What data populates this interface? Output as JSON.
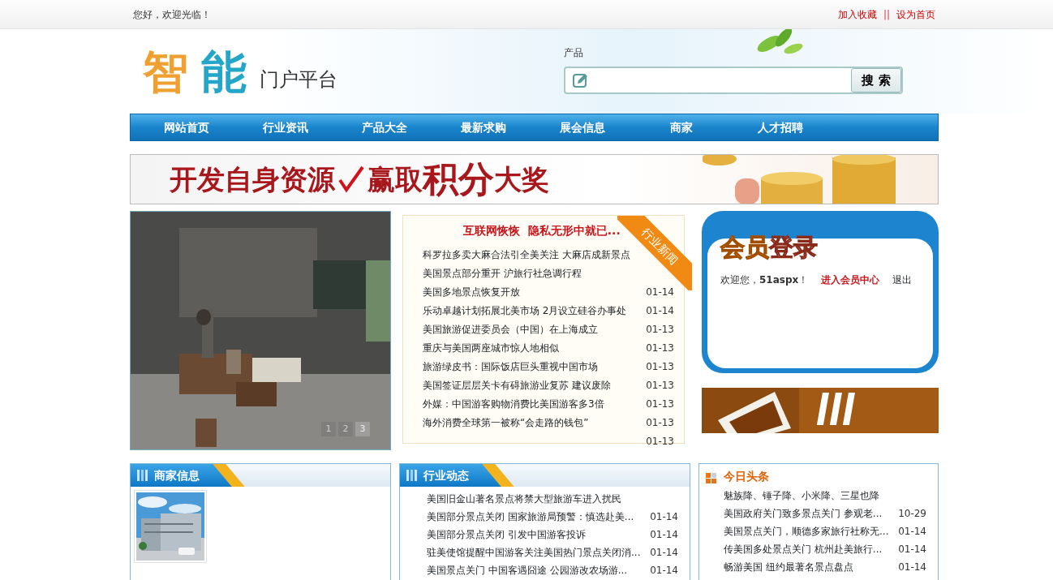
{
  "top_bar": {
    "greeting": "您好，欢迎光临！",
    "links": [
      "加入收藏",
      "设为首页"
    ],
    "separator": "||"
  },
  "logo": {
    "chars": [
      {
        "text": "智",
        "color": "#f0a030"
      },
      {
        "text": "能",
        "color": "#23a6c8"
      }
    ],
    "subtitle": "门户平台"
  },
  "search": {
    "label": "产品",
    "button": "搜 索"
  },
  "nav": [
    "网站首页",
    "行业资讯",
    "产品大全",
    "最新求购",
    "展会信息",
    "商家",
    "人才招聘"
  ],
  "banner": {
    "segments": [
      {
        "text": "开发自身资源",
        "emphasis": false
      },
      {
        "text": "赢取",
        "emphasis": false
      },
      {
        "text": "积分",
        "emphasis": true
      },
      {
        "text": "大奖",
        "emphasis": false
      }
    ]
  },
  "slideshow": {
    "pager": [
      {
        "label": "1",
        "selected": false
      },
      {
        "label": "2",
        "selected": false
      },
      {
        "label": "3",
        "selected": true
      }
    ]
  },
  "news": {
    "ribbon": "行业新闻",
    "headline": "互联网恢恢  隐私无形中就已...",
    "rows": [
      {
        "title": "科罗拉多卖大麻合法引全美关注 大麻店成新景点"
      },
      {
        "title": "美国景点部分重开 沪旅行社急调行程"
      },
      {
        "title": "美国多地景点恢复开放",
        "date": "01-14"
      },
      {
        "title": "乐动卓越计划拓展北美市场 2月设立硅谷办事处",
        "date": "01-14"
      },
      {
        "title": "美国旅游促进委员会（中国）在上海成立",
        "date": "01-13"
      },
      {
        "title": "重庆与美国两座城市惊人地相似",
        "date": "01-13"
      },
      {
        "title": "旅游绿皮书：国际饭店巨头重视中国市场",
        "date": "01-13"
      },
      {
        "title": "美国签证层层关卡有碍旅游业复苏 建议废除",
        "date": "01-13"
      },
      {
        "title": "外媒：中国游客购物消费比美国游客多3倍",
        "date": "01-13"
      },
      {
        "title": "海外消费全球第一被称“会走路的钱包”",
        "date": "01-13"
      },
      {
        "date": "01-13"
      }
    ]
  },
  "member": {
    "title_parts": [
      {
        "text": "会员",
        "kind": "solid"
      },
      {
        "text": "登录",
        "kind": "outline"
      }
    ],
    "welcome": "欢迎您，**51aspx**！",
    "center_link": "进入会员中心",
    "logout": "退出"
  },
  "merchants": {
    "title": "商家信息"
  },
  "industry": {
    "title": "行业动态",
    "items": [
      {
        "title": "美国旧金山著名景点将禁大型旅游车进入扰民"
      },
      {
        "title": "美国部分景点关闭 国家旅游局预警：慎选赴美...",
        "date": "01-14"
      },
      {
        "title": "美国部分景点关闭 引发中国游客投诉",
        "date": "01-14"
      },
      {
        "title": "驻美使馆提醒中国游客关注美国热门景点关闭消...",
        "date": "01-14"
      },
      {
        "title": "美国景点关门 中国客遇囧途 公园游改农场游...",
        "date": "01-14"
      }
    ]
  },
  "headlines": {
    "title": "今日头条",
    "items": [
      {
        "title": "魅族降、锤子降、小米降、三星也降"
      },
      {
        "title": "美国政府关门致多景点关门 参观老...",
        "date": "10-29"
      },
      {
        "title": "美国景点关门，顺德多家旅行社称无...",
        "date": "01-14"
      },
      {
        "title": "传美国多处景点关门 杭州赴美旅行...",
        "date": "01-14"
      },
      {
        "title": "畅游美国 纽约最著名景点盘点",
        "date": "01-14"
      }
    ]
  }
}
